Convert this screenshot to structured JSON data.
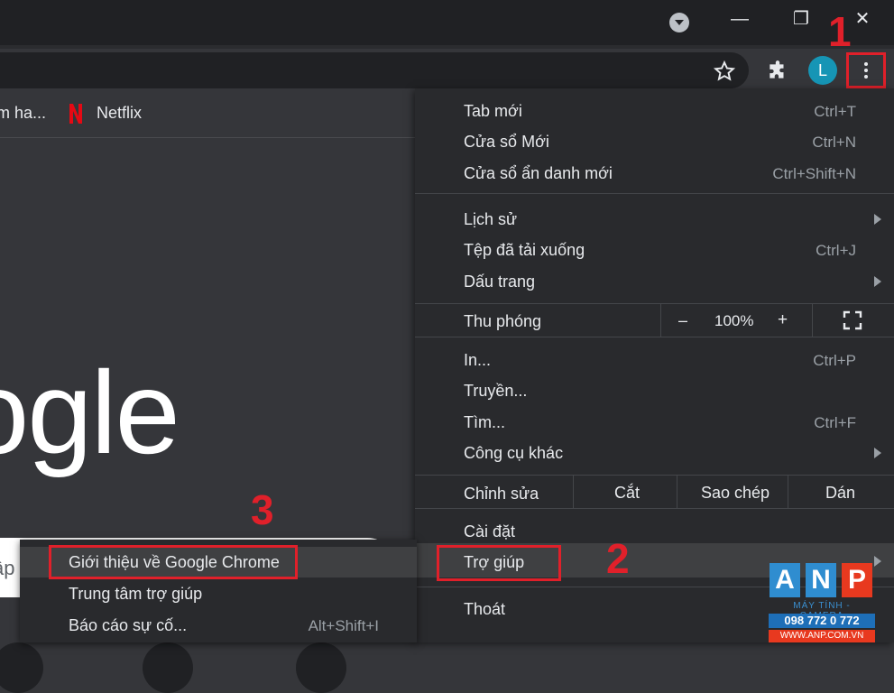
{
  "window": {
    "minimize_glyph": "—",
    "restore_glyph": "❐",
    "close_glyph": "✕"
  },
  "toolbar": {
    "avatar_letter": "L"
  },
  "bookmarks": [
    {
      "label": "m ha..."
    },
    {
      "label": "Netflix"
    }
  ],
  "page": {
    "google_logo_text": "ogle",
    "search_hint": "ập"
  },
  "main_menu": {
    "new_tab": {
      "label": "Tab mới",
      "shortcut": "Ctrl+T"
    },
    "new_window": {
      "label": "Cửa sổ Mới",
      "shortcut": "Ctrl+N"
    },
    "incognito": {
      "label": "Cửa sổ ẩn danh mới",
      "shortcut": "Ctrl+Shift+N"
    },
    "history": {
      "label": "Lịch sử"
    },
    "downloads": {
      "label": "Tệp đã tải xuống",
      "shortcut": "Ctrl+J"
    },
    "bookmarks": {
      "label": "Dấu trang"
    },
    "zoom": {
      "label": "Thu phóng",
      "minus": "–",
      "value": "100%",
      "plus": "+"
    },
    "print": {
      "label": "In...",
      "shortcut": "Ctrl+P"
    },
    "cast": {
      "label": "Truyền..."
    },
    "find": {
      "label": "Tìm...",
      "shortcut": "Ctrl+F"
    },
    "more_tools": {
      "label": "Công cụ khác"
    },
    "edit": {
      "label": "Chỉnh sửa",
      "cut": "Cắt",
      "copy": "Sao chép",
      "paste": "Dán"
    },
    "settings": {
      "label": "Cài đặt"
    },
    "help": {
      "label": "Trợ giúp"
    },
    "exit": {
      "label": "Thoát"
    }
  },
  "sub_menu": {
    "about": {
      "label": "Giới thiệu về Google Chrome"
    },
    "help_center": {
      "label": "Trung tâm trợ giúp"
    },
    "report": {
      "label": "Báo cáo sự cố...",
      "shortcut": "Alt+Shift+I"
    }
  },
  "annotations": {
    "step1": "1",
    "step2": "2",
    "step3": "3"
  },
  "watermark": {
    "letters": [
      "A",
      "N",
      "P"
    ],
    "tagline": "MÁY TÍNH - CAMERA",
    "phone": "098 772 0 772",
    "site": "WWW.ANP.COM.VN"
  },
  "colors": {
    "annotation_red": "#e0202a",
    "menu_bg": "#292a2d",
    "highlight_row": "#3f4042",
    "avatar_bg": "#1695b5"
  }
}
